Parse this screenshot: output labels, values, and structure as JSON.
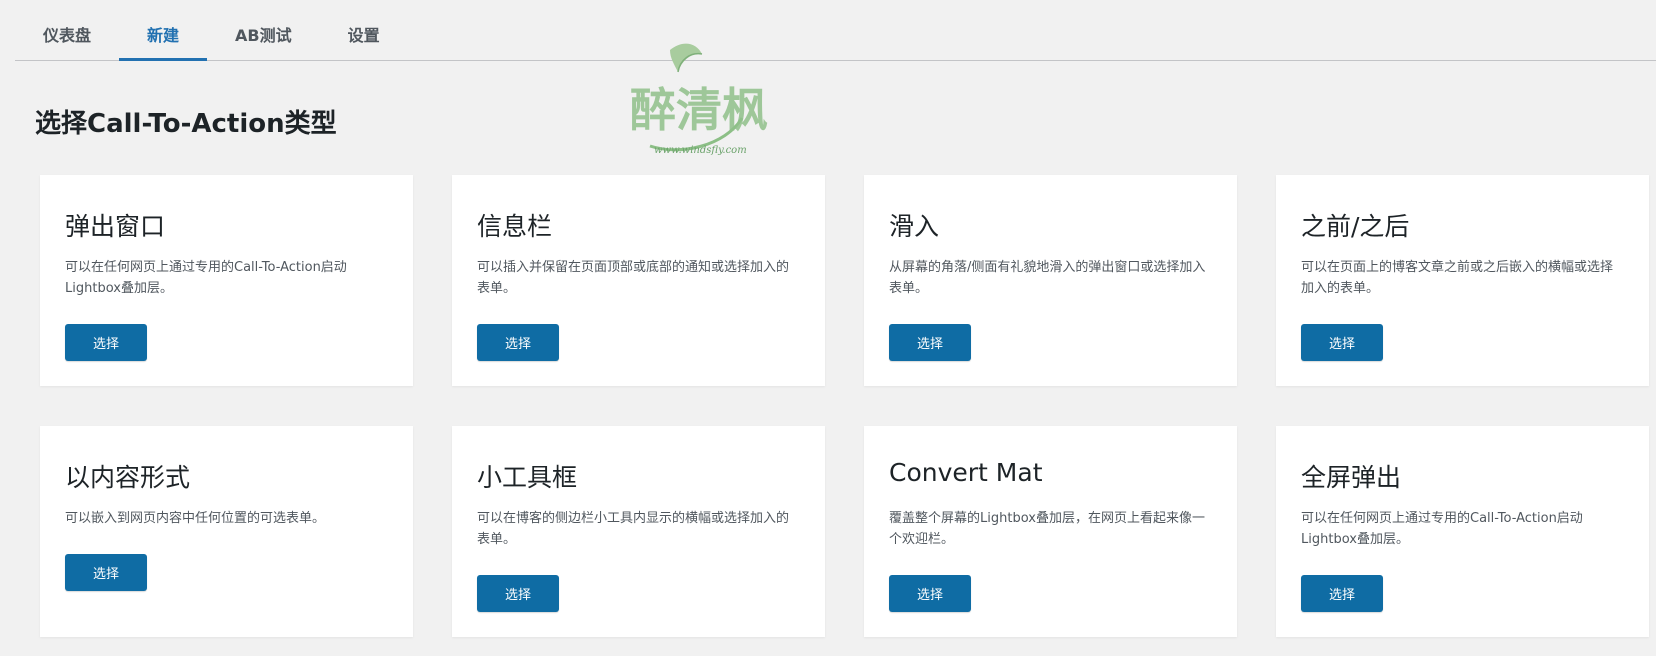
{
  "tabs": [
    {
      "label": "仪表盘",
      "active": false
    },
    {
      "label": "新建",
      "active": true
    },
    {
      "label": "AB测试",
      "active": false
    },
    {
      "label": "设置",
      "active": false
    }
  ],
  "page_title": "选择Call-To-Action类型",
  "watermark": {
    "text": "醉清枫",
    "url": "www.windsfly.com"
  },
  "colors": {
    "accent": "#2271b1",
    "button": "#0f6ca4",
    "logo_green": "#7fb07a"
  },
  "cards": [
    {
      "title": "弹出窗口",
      "desc": "可以在任何网页上通过专用的Call-To-Action启动Lightbox叠加层。",
      "button": "选择"
    },
    {
      "title": "信息栏",
      "desc": "可以插入并保留在页面顶部或底部的通知或选择加入的表单。",
      "button": "选择"
    },
    {
      "title": "滑入",
      "desc": "从屏幕的角落/侧面有礼貌地滑入的弹出窗口或选择加入表单。",
      "button": "选择"
    },
    {
      "title": "之前/之后",
      "desc": "可以在页面上的博客文章之前或之后嵌入的横幅或选择加入的表单。",
      "button": "选择"
    },
    {
      "title": "以内容形式",
      "desc": "可以嵌入到网页内容中任何位置的可选表单。",
      "button": "选择"
    },
    {
      "title": "小工具框",
      "desc": "可以在博客的侧边栏小工具内显示的横幅或选择加入的表单。",
      "button": "选择"
    },
    {
      "title": "Convert Mat",
      "desc": "覆盖整个屏幕的Lightbox叠加层，在网页上看起来像一个欢迎栏。",
      "button": "选择"
    },
    {
      "title": "全屏弹出",
      "desc": "可以在任何网页上通过专用的Call-To-Action启动Lightbox叠加层。",
      "button": "选择"
    }
  ]
}
